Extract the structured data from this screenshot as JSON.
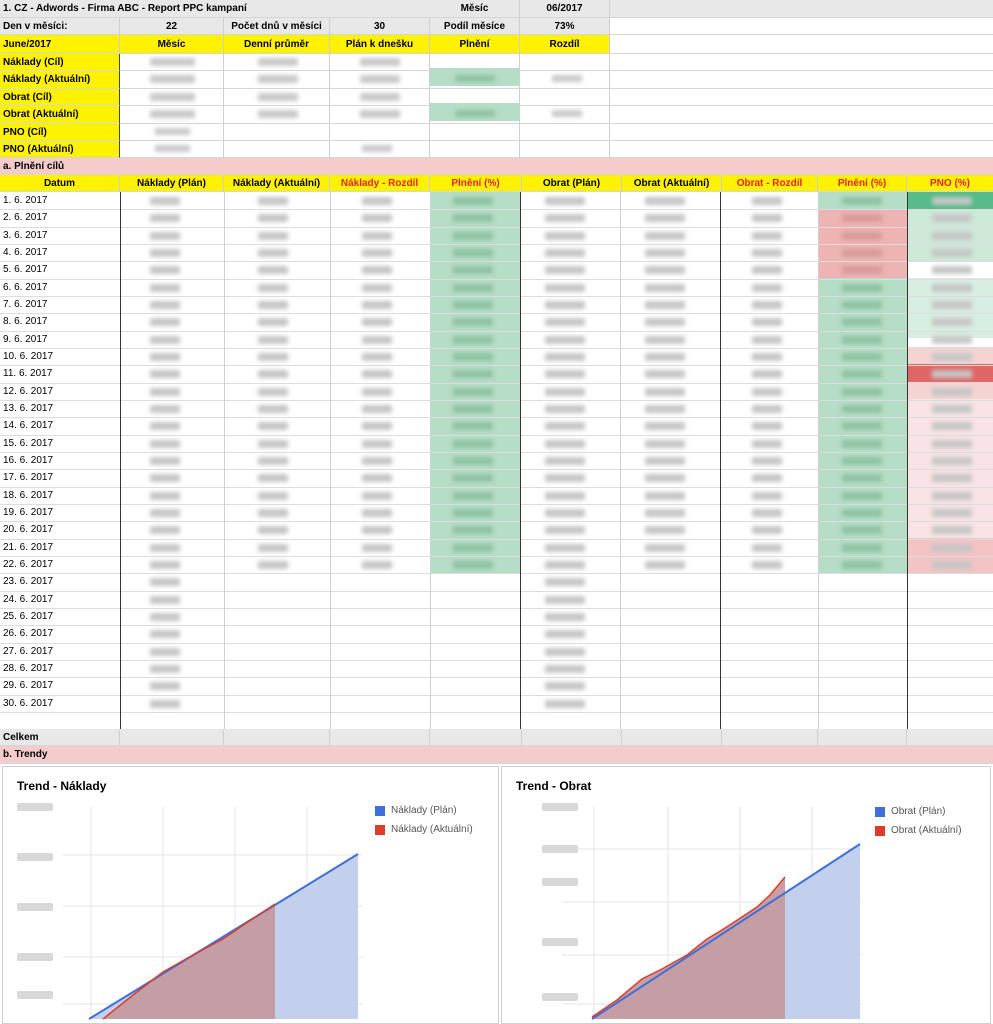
{
  "header": {
    "title": "1. CZ - Adwords - Firma ABC - Report PPC kampaní",
    "month_label": "Měsíc",
    "month_value": "06/2017",
    "days_label": "Den v měsíci:",
    "days_value": "22",
    "days_in_month_label": "Počet dnů v měsíci",
    "days_in_month_value": "30",
    "share_label": "Podíl měsíce",
    "share_value": "73%"
  },
  "summary": {
    "period": "June/2017",
    "columns": [
      "Měsíc",
      "Denní průměr",
      "Plán k dnešku",
      "Plnění",
      "Rozdíl"
    ],
    "rows": [
      "Náklady (Cíl)",
      "Náklady (Aktuální)",
      "Obrat (Cíl)",
      "Obrat (Aktuální)",
      "PNO (Cíl)",
      "PNO (Aktuální)"
    ]
  },
  "section_a": "a. Plnění cílů",
  "daily": {
    "columns": [
      "Datum",
      "Náklady (Plán)",
      "Náklady (Aktuální)",
      "Náklady - Rozdíl",
      "Plnění (%)",
      "Obrat (Plán)",
      "Obrat (Aktuální)",
      "Obrat - Rozdíl",
      "Plnění (%)",
      "PNO (%)"
    ],
    "dates": [
      "1. 6. 2017",
      "2. 6. 2017",
      "3. 6. 2017",
      "4. 6. 2017",
      "5. 6. 2017",
      "6. 6. 2017",
      "7. 6. 2017",
      "8. 6. 2017",
      "9. 6. 2017",
      "10. 6. 2017",
      "11. 6. 2017",
      "12. 6. 2017",
      "13. 6. 2017",
      "14. 6. 2017",
      "15. 6. 2017",
      "16. 6. 2017",
      "17. 6. 2017",
      "18. 6. 2017",
      "19. 6. 2017",
      "20. 6. 2017",
      "21. 6. 2017",
      "22. 6. 2017",
      "23. 6. 2017",
      "24. 6. 2017",
      "25. 6. 2017",
      "26. 6. 2017",
      "27. 6. 2017",
      "28. 6. 2017",
      "29. 6. 2017",
      "30. 6. 2017"
    ],
    "total_label": "Celkem"
  },
  "section_b": "b. Trendy",
  "colors": {
    "plan": "#3f6fd8",
    "actual": "#dc3d2a",
    "plan_fill": "#c2d0ee",
    "actual_fill": "#c49aa0"
  },
  "chart_data": [
    {
      "type": "area",
      "title": "Trend - Náklady",
      "series": [
        {
          "name": "Náklady (Plán)"
        },
        {
          "name": "Náklady (Aktuální)"
        }
      ]
    },
    {
      "type": "area",
      "title": "Trend - Obrat",
      "series": [
        {
          "name": "Obrat (Plán)"
        },
        {
          "name": "Obrat (Aktuální)"
        }
      ]
    }
  ]
}
